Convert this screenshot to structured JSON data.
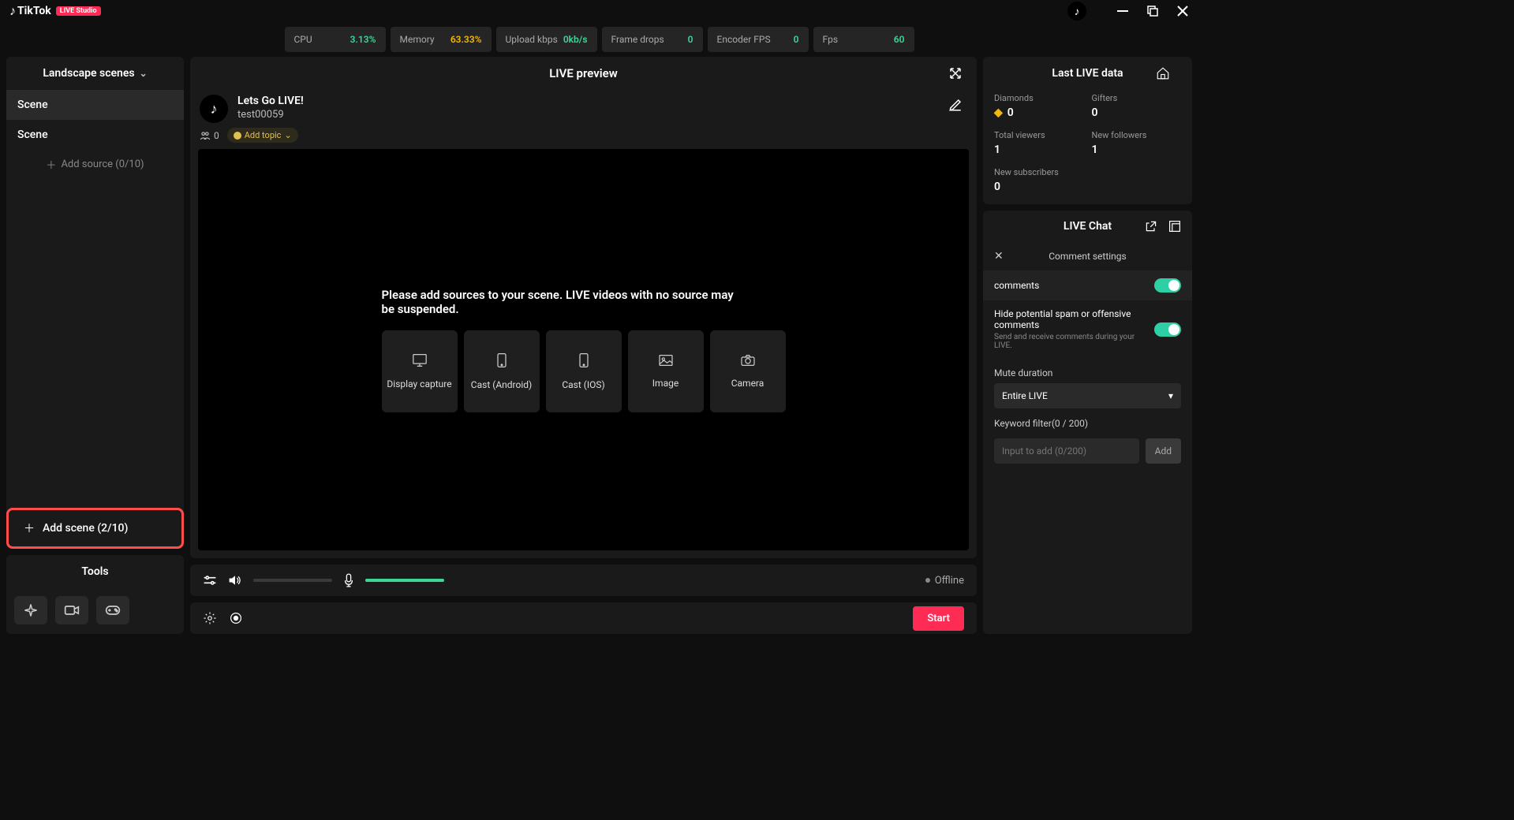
{
  "header": {
    "app_name": "TikTok",
    "badge": "LIVE Studio"
  },
  "stats": {
    "cpu": {
      "label": "CPU",
      "value": "3.13%"
    },
    "memory": {
      "label": "Memory",
      "value": "63.33%"
    },
    "upload": {
      "label": "Upload kbps",
      "value": "0kb/s"
    },
    "frame_drops": {
      "label": "Frame drops",
      "value": "0"
    },
    "encoder_fps": {
      "label": "Encoder FPS",
      "value": "0"
    },
    "fps": {
      "label": "Fps",
      "value": "60"
    }
  },
  "sidebar": {
    "title": "Landscape scenes",
    "scenes": [
      "Scene",
      "Scene"
    ],
    "add_source": "Add source (0/10)",
    "add_scene": "Add scene (2/10)"
  },
  "tools": {
    "title": "Tools"
  },
  "preview": {
    "title": "LIVE preview",
    "stream_title": "Lets Go LIVE!",
    "username": "test00059",
    "viewers": "0",
    "add_topic": "Add topic",
    "empty_msg": "Please add sources to your scene. LIVE videos with no source may be suspended.",
    "sources": [
      "Display capture",
      "Cast (Android)",
      "Cast (IOS)",
      "Image",
      "Camera"
    ]
  },
  "audio": {
    "status": "Offline"
  },
  "start": {
    "button": "Start"
  },
  "live_data": {
    "title": "Last LIVE data",
    "diamonds": {
      "label": "Diamonds",
      "value": "0"
    },
    "gifters": {
      "label": "Gifters",
      "value": "0"
    },
    "total_viewers": {
      "label": "Total viewers",
      "value": "1"
    },
    "new_followers": {
      "label": "New followers",
      "value": "1"
    },
    "new_subscribers": {
      "label": "New subscribers",
      "value": "0"
    }
  },
  "chat": {
    "title": "LIVE Chat",
    "settings_title": "Comment settings",
    "comments_label": "comments",
    "spam_label": "Hide potential spam or offensive comments",
    "spam_sub": "Send and receive comments during your LIVE.",
    "mute_label": "Mute duration",
    "mute_value": "Entire LIVE",
    "keyword_label": "Keyword filter(0 / 200)",
    "keyword_placeholder": "Input to add (0/200)",
    "add_button": "Add"
  }
}
